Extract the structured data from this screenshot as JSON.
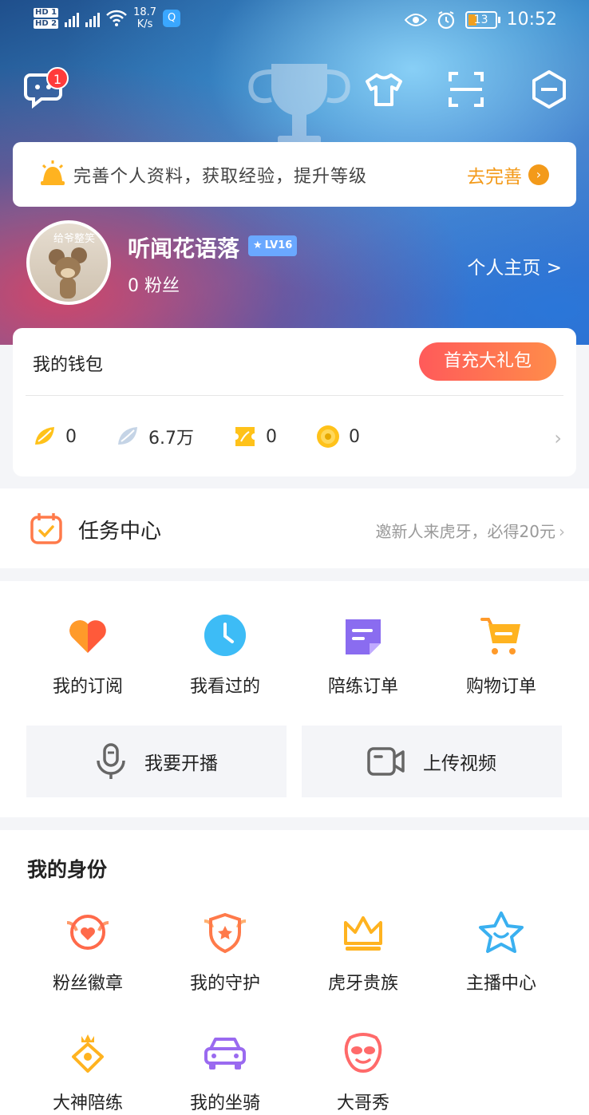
{
  "status_bar": {
    "sim1": "HD 1",
    "sim2": "HD 2",
    "speed_value": "18.7",
    "speed_unit": "K/s",
    "battery": "13",
    "time": "10:52"
  },
  "header": {
    "message_badge": "1",
    "icons": [
      "message-icon",
      "tshirt-icon",
      "scan-icon",
      "minus-hexagon-icon"
    ]
  },
  "banner": {
    "text": "完善个人资料，获取经验，提升等级",
    "cta": "去完善"
  },
  "profile": {
    "avatar_caption": "给爷整笑",
    "username": "听闻花语落",
    "level": "LV16",
    "fans": "0 粉丝",
    "homepage": "个人主页 >"
  },
  "wallet": {
    "title": "我的钱包",
    "button": "首充大礼包",
    "items": [
      {
        "icon": "gold-bean-icon",
        "value": "0"
      },
      {
        "icon": "silver-bean-icon",
        "value": "6.7万"
      },
      {
        "icon": "ticket-icon",
        "value": "0"
      },
      {
        "icon": "coin-icon",
        "value": "0"
      }
    ]
  },
  "task_center": {
    "title": "任务中心",
    "hint": "邀新人来虎牙，必得20元"
  },
  "quick_actions": [
    {
      "label": "我的订阅",
      "icon": "heart-icon"
    },
    {
      "label": "我看过的",
      "icon": "clock-icon"
    },
    {
      "label": "陪练订单",
      "icon": "note-icon"
    },
    {
      "label": "购物订单",
      "icon": "cart-icon"
    }
  ],
  "big_buttons": [
    {
      "label": "我要开播",
      "icon": "microphone-icon"
    },
    {
      "label": "上传视频",
      "icon": "video-camera-icon"
    }
  ],
  "identity": {
    "title": "我的身份",
    "items": [
      {
        "label": "粉丝徽章",
        "icon": "fan-badge-icon"
      },
      {
        "label": "我的守护",
        "icon": "guard-shield-icon"
      },
      {
        "label": "虎牙贵族",
        "icon": "crown-icon"
      },
      {
        "label": "主播中心",
        "icon": "star-icon"
      },
      {
        "label": "大神陪练",
        "icon": "master-badge-icon"
      },
      {
        "label": "我的坐骑",
        "icon": "car-icon"
      },
      {
        "label": "大哥秀",
        "icon": "sunglasses-face-icon"
      }
    ]
  },
  "colors": {
    "accent_orange": "#f39a1a",
    "wallet_gradient_start": "#ff5a5a",
    "wallet_gradient_end": "#ff8c4a",
    "badge_red": "#ff3b3b"
  }
}
